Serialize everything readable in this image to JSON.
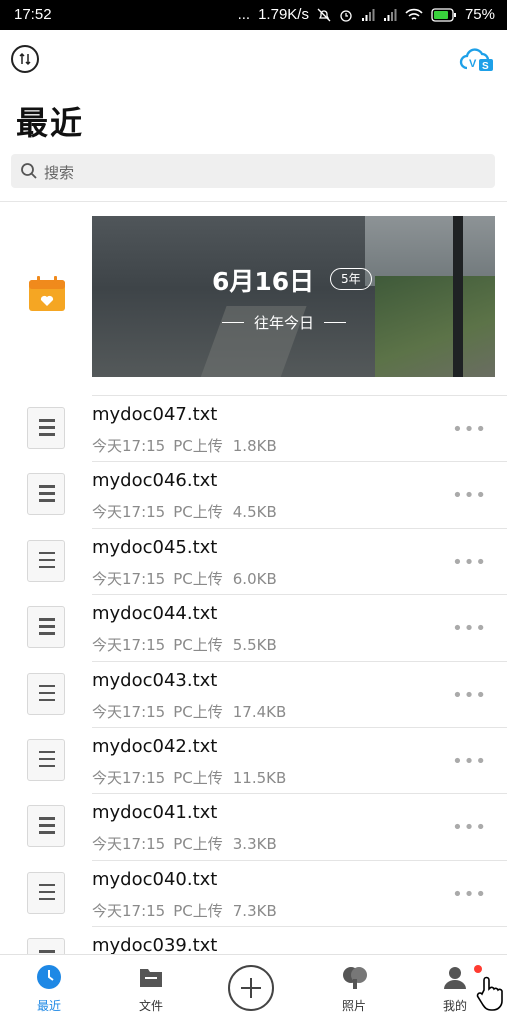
{
  "status_bar": {
    "time": "17:52",
    "dots": "...",
    "speed": "1.79K/s",
    "battery": "75%"
  },
  "header": {
    "title": "最近",
    "search_placeholder": "搜索"
  },
  "memory": {
    "date": "6月16日",
    "badge": "5年",
    "subtitle": "往年今日"
  },
  "files": [
    {
      "name": "mydoc047.txt",
      "time": "今天17:15",
      "source": "PC上传",
      "size": "1.8KB"
    },
    {
      "name": "mydoc046.txt",
      "time": "今天17:15",
      "source": "PC上传",
      "size": "4.5KB"
    },
    {
      "name": "mydoc045.txt",
      "time": "今天17:15",
      "source": "PC上传",
      "size": "6.0KB"
    },
    {
      "name": "mydoc044.txt",
      "time": "今天17:15",
      "source": "PC上传",
      "size": "5.5KB"
    },
    {
      "name": "mydoc043.txt",
      "time": "今天17:15",
      "source": "PC上传",
      "size": "17.4KB"
    },
    {
      "name": "mydoc042.txt",
      "time": "今天17:15",
      "source": "PC上传",
      "size": "11.5KB"
    },
    {
      "name": "mydoc041.txt",
      "time": "今天17:15",
      "source": "PC上传",
      "size": "3.3KB"
    },
    {
      "name": "mydoc040.txt",
      "time": "今天17:15",
      "source": "PC上传",
      "size": "7.3KB"
    },
    {
      "name": "mydoc039.txt",
      "time": "",
      "source": "",
      "size": ""
    }
  ],
  "more_label": "•••",
  "tabs": [
    {
      "label": "最近",
      "icon": "clock-icon"
    },
    {
      "label": "文件",
      "icon": "folder-icon"
    },
    {
      "label": "",
      "icon": "plus-icon"
    },
    {
      "label": "照片",
      "icon": "photos-icon"
    },
    {
      "label": "我的",
      "icon": "profile-icon"
    }
  ],
  "colors": {
    "accent": "#1e88e5",
    "calendar": "#f5a623",
    "cloud": "#1ea0e8"
  }
}
